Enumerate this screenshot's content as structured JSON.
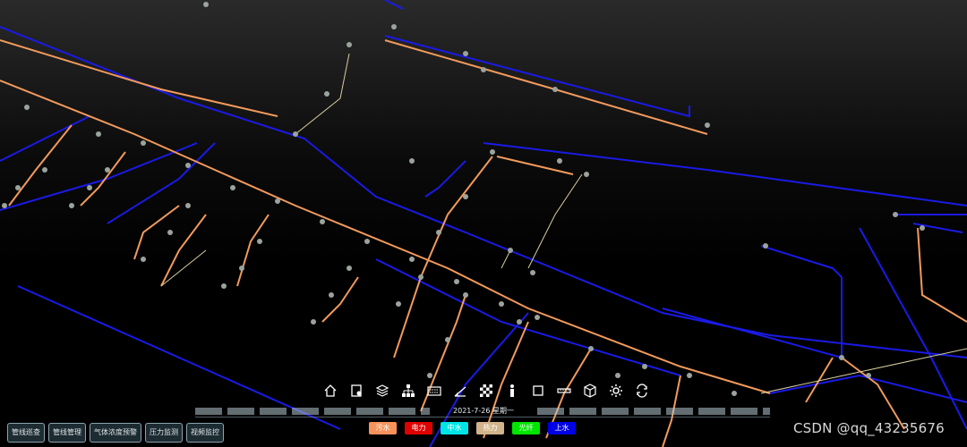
{
  "colors": {
    "background": "#000000",
    "water_supply_line": "#1a1ae6",
    "sewage_line": "#f29a5c",
    "other_line": "#d8cfa0"
  },
  "toolbar": {
    "tools": [
      {
        "icon": "home-icon"
      },
      {
        "icon": "document-icon"
      },
      {
        "icon": "layers-icon"
      },
      {
        "icon": "network-icon"
      },
      {
        "icon": "keyboard-icon"
      },
      {
        "icon": "ruler-angle-icon"
      },
      {
        "icon": "checkerboard-icon"
      },
      {
        "icon": "person-icon"
      },
      {
        "icon": "square-icon"
      },
      {
        "icon": "measure-icon"
      },
      {
        "icon": "cube-icon"
      },
      {
        "icon": "gear-icon"
      },
      {
        "icon": "refresh-icon"
      }
    ]
  },
  "datebar": {
    "text": "2021-7-26 星期一"
  },
  "legend": [
    {
      "label": "污水",
      "color": "#f7925b"
    },
    {
      "label": "电力",
      "color": "#e00000"
    },
    {
      "label": "中水",
      "color": "#00e5e5"
    },
    {
      "label": "热力",
      "color": "#d2b48c"
    },
    {
      "label": "光纤",
      "color": "#00e600"
    },
    {
      "label": "上水",
      "color": "#0000e6"
    }
  ],
  "leftButtons": [
    {
      "label": "管线巡查"
    },
    {
      "label": "管线管理"
    },
    {
      "label": "气体浓度预警"
    },
    {
      "label": "压力监测"
    },
    {
      "label": "视频监控"
    }
  ],
  "watermark": "CSDN @qq_43235676"
}
